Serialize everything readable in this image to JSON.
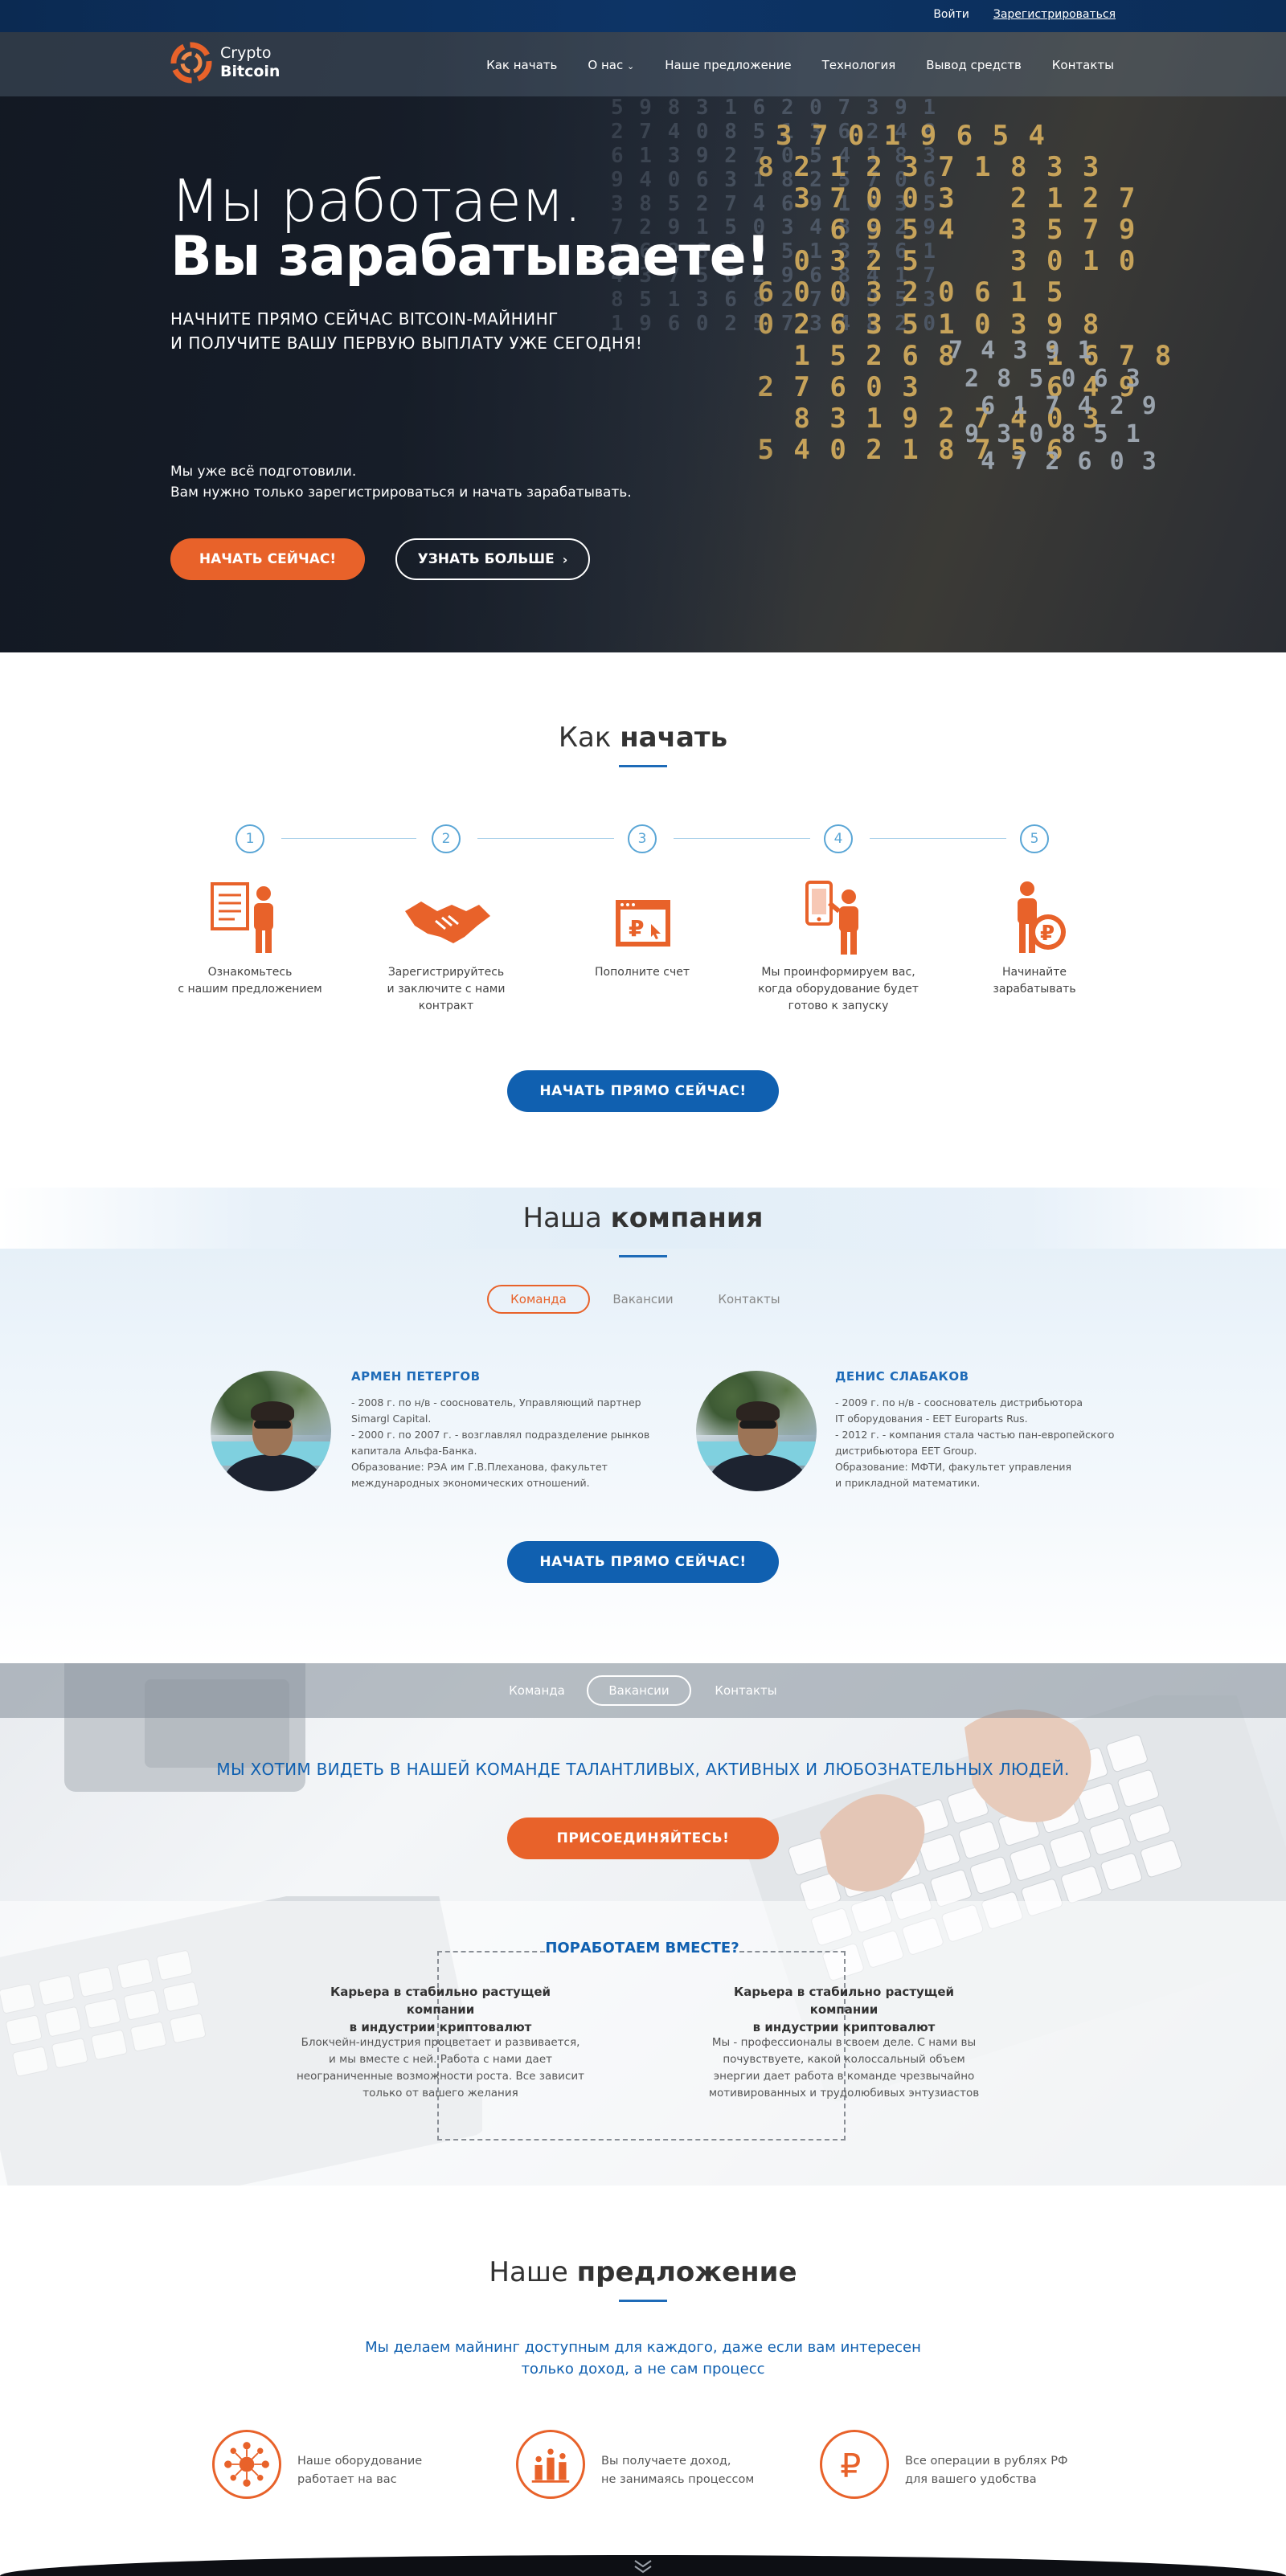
{
  "header": {
    "login": "Войти",
    "register": "Зарегистрироваться",
    "logo_line1": "Crypto",
    "logo_line2": "Bitcoin",
    "nav": [
      "Как начать",
      "О нас",
      "Наше предложение",
      "Технология",
      "Вывод средств",
      "Контакты"
    ]
  },
  "hero": {
    "title_light": "Мы работаем.",
    "title_bold": "Вы зарабатываете!",
    "subtitle_line1": "НАЧНИТЕ ПРЯМО СЕЙЧАС BITCOIN-МАЙНИНГ",
    "subtitle_line2": "И ПОЛУЧИТЕ ВАШУ ПЕРВУЮ ВЫПЛАТУ УЖЕ СЕГОДНЯ!",
    "text_line1": "Мы уже всё подготовили.",
    "text_line2": "Вам нужно только зарегистрироваться и начать зарабатывать.",
    "cta_primary": "НАЧАТЬ СЕЙЧАС!",
    "cta_secondary": "УЗНАТЬ БОЛЬШЕ"
  },
  "how_to_start": {
    "title_light": "Как",
    "title_bold": "начать",
    "steps": [
      {
        "num": "1",
        "icon": "document-person-icon",
        "label": "Ознакомьтесь\nс нашим предложением"
      },
      {
        "num": "2",
        "icon": "handshake-icon",
        "label": "Зарегистрируйтесь\nи заключите с нами\nконтракт"
      },
      {
        "num": "3",
        "icon": "ruble-payment-window-icon",
        "label": "Пополните счет"
      },
      {
        "num": "4",
        "icon": "phone-person-icon",
        "label": "Мы проинформируем вас,\nкогда оборудование будет\nготово к запуску"
      },
      {
        "num": "5",
        "icon": "person-ruble-coin-icon",
        "label": "Начинайте\nзарабатывать"
      }
    ],
    "cta": "НАЧАТЬ ПРЯМО СЕЙЧАС!"
  },
  "company": {
    "title_light": "Наша",
    "title_bold": "компания",
    "tabs": [
      "Команда",
      "Вакансии",
      "Контакты"
    ],
    "people": [
      {
        "name": "АРМЕН ПЕТЕРГОВ",
        "bio": "- 2008 г. по н/в - сооснователь, Управляющий партнер\nSimargl Capital.\n- 2000 г. по 2007 г. - возглавлял подразделение рынков\nкапитала Альфа-Банка.\nОбразование: РЭА им Г.В.Плеханова, факультет\nмеждународных экономических отношений."
      },
      {
        "name": "ДЕНИС СЛАБАКОВ",
        "bio": "- 2009 г. по н/в - сооснователь дистрибьютора\nIT оборудования - EET Europarts Rus.\n- 2012 г. - компания стала частью пан-европейского\nдистрибьютора EET Group.\nОбразование: МФТИ, факультет управления\nи прикладной математики."
      }
    ],
    "cta": "НАЧАТЬ ПРЯМО СЕЙЧАС!"
  },
  "vacancies": {
    "tabs": [
      "Команда",
      "Вакансии",
      "Контакты"
    ],
    "headline": "МЫ ХОТИМ ВИДЕТЬ В НАШЕЙ КОМАНДЕ ТАЛАНТЛИВЫХ, АКТИВНЫХ И ЛЮБОЗНАТЕЛЬНЫХ ЛЮДЕЙ.",
    "cta": "ПРИСОЕДИНЯЙТЕСЬ!",
    "together": "ПОРАБОТАЕМ ВМЕСТЕ?",
    "columns": [
      {
        "title": "Карьера в стабильно растущей компании\nв индустрии криптовалют",
        "text": "Блокчейн-индустрия процветает и развивается,\nи мы вместе с ней. Работа с нами дает\nнеограниченные возможности роста. Все зависит\nтолько от вашего желания"
      },
      {
        "title": "Карьера в стабильно растущей компании\nв индустрии криптовалют",
        "text": "Мы - профессионалы в своем деле. С нами вы\nпочувствуете, какой колоссальный объем\nэнергии дает работа в команде чрезвычайно\nмотивированных и трудолюбивых энтузиастов"
      }
    ]
  },
  "offer": {
    "title_light": "Наше",
    "title_bold": "предложение",
    "subtitle": "Мы делаем майнинг доступным для каждого, даже если вам интересен\nтолько доход, а не сам процесс",
    "items": [
      {
        "icon": "network-people-icon",
        "text": "Наше оборудование\nработает на вас"
      },
      {
        "icon": "growth-chart-icon",
        "text": "Вы получаете доход,\nне занимаясь процессом"
      },
      {
        "icon": "ruble-icon",
        "text": "Все операции в рублях РФ\nдля вашего удобства"
      }
    ]
  },
  "colors": {
    "accent_orange": "#e8622a",
    "accent_blue": "#1060b0",
    "step_blue": "#5aa6d6"
  }
}
